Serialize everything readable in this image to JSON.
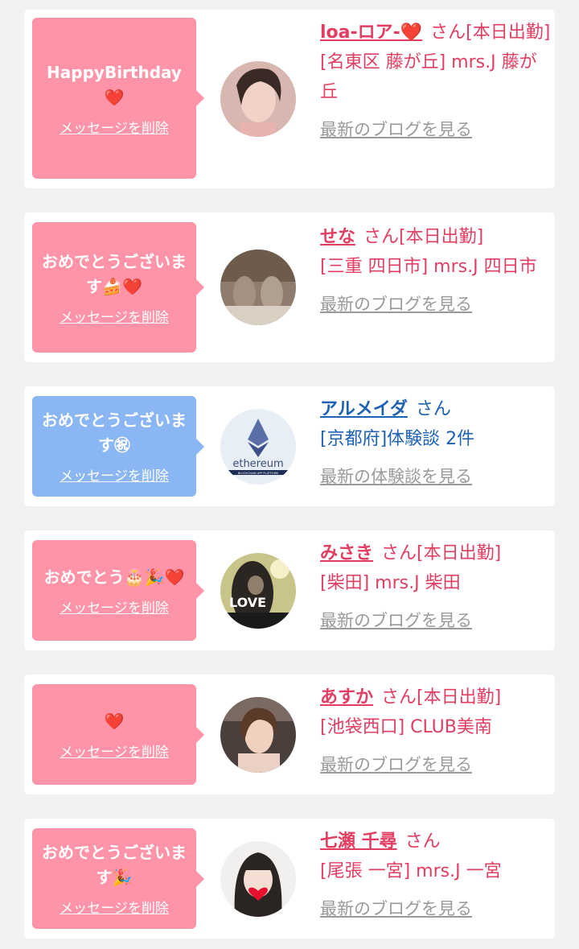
{
  "cards": [
    {
      "message": "HappyBirthday❤️",
      "delete_label": "メッセージを削除",
      "name": "loa-ロア-❤️",
      "suffix": "さん[本日出勤]",
      "shop": "[名東区 藤が丘] mrs.J 藤が丘",
      "link": "最新のブログを見る"
    },
    {
      "message": "おめでとうございます🍰❤️",
      "delete_label": "メッセージを削除",
      "name": "せな",
      "suffix": "さん[本日出勤]",
      "shop": "[三重 四日市] mrs.J 四日市",
      "link": "最新のブログを見る"
    },
    {
      "message": "おめでとうございます㊗",
      "delete_label": "メッセージを削除",
      "name": "アルメイダ",
      "suffix": "さん",
      "shop": "[京都府]体験談 2件",
      "link": "最新の体験談を見る",
      "avatar_text": "ethereum",
      "avatar_subtext": "BLOCKCHAIN APP PLATFORM"
    },
    {
      "message": "おめでとう🎂🎉❤️",
      "delete_label": "メッセージを削除",
      "name": "みさき",
      "suffix": "さん[本日出勤]",
      "shop": "[柴田] mrs.J 柴田",
      "link": "最新のブログを見る",
      "avatar_text": "LOVE"
    },
    {
      "message": "❤️",
      "delete_label": "メッセージを削除",
      "name": "あすか",
      "suffix": "さん[本日出勤]",
      "shop": "[池袋西口] CLUB美南",
      "link": "最新のブログを見る"
    },
    {
      "message": "おめでとうございます🎉",
      "delete_label": "メッセージを削除",
      "name": "七瀬 千尋",
      "suffix": "さん",
      "shop": "[尾張 一宮] mrs.J 一宮",
      "link": "最新のブログを見る"
    }
  ],
  "colors": {
    "pink_bubble": "#ff94a8",
    "blue_bubble": "#8ab6f4",
    "pink_text": "#e23e62",
    "blue_text": "#1f62b4",
    "link_gray": "#9a9a9a"
  }
}
